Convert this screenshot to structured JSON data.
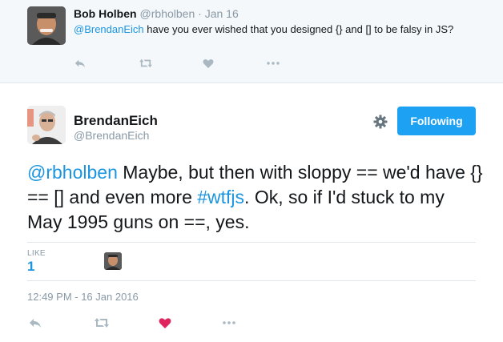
{
  "parent_tweet": {
    "name": "Bob Holben",
    "handle_and_date": "@rbholben · Jan 16",
    "mention": "@BrendanEich",
    "text": " have you ever wished that you designed {} and [] to be falsy in JS?",
    "icons": [
      "reply-icon",
      "retweet-icon",
      "like-icon",
      "more-icon"
    ]
  },
  "main_tweet": {
    "name": "BrendanEich",
    "handle": "@BrendanEich",
    "follow_label": "Following",
    "text_mention": "@rbholben",
    "text_part1": " Maybe, but then with sloppy == we'd have {} == [] and even more ",
    "hashtag": "#wtfjs",
    "text_part2": ". Ok, so if I'd stuck to my May 1995 guns on ==, yes.",
    "likes_label": "LIKE",
    "likes_count": "1",
    "timestamp": "12:49 PM - 16 Jan 2016",
    "icons": [
      "reply-icon",
      "retweet-icon",
      "liked-heart-icon",
      "more-icon"
    ],
    "colors": {
      "accent": "#1da1f2",
      "link": "#1b95e0",
      "liked": "#e0245e",
      "muted": "#8899a6"
    }
  }
}
